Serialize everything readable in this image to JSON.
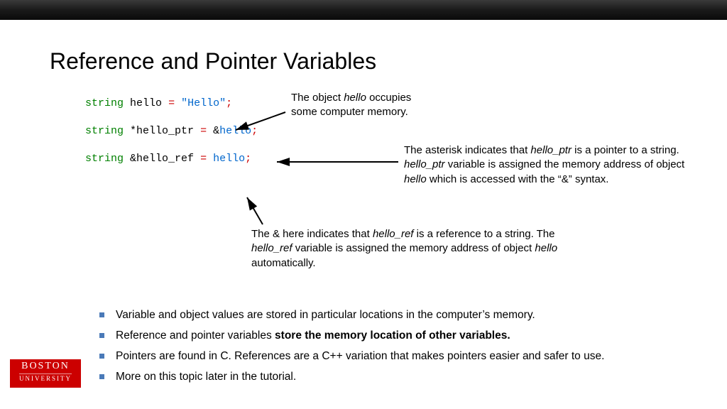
{
  "title": "Reference and Pointer Variables",
  "code": {
    "line1": {
      "kw": "string",
      "sp1": " ",
      "id": "hello",
      "sp2": " ",
      "op1": "=",
      "sp3": " ",
      "str": "\"Hello\"",
      "op2": ";"
    },
    "line2": {
      "kw": "string",
      "sp1": " ",
      "star": "*",
      "id": "hello_ptr",
      "sp2": " ",
      "op1": "=",
      "sp3": " ",
      "amp": "&",
      "ref": "hello",
      "op2": ";"
    },
    "line3": {
      "kw": "string",
      "sp1": " ",
      "amp": "&",
      "id": "hello_ref",
      "sp2": " ",
      "op1": "=",
      "sp3": " ",
      "ref": "hello",
      "op2": ";"
    }
  },
  "annotations": {
    "a1": "The object <em>hello</em> occupies some computer memory.",
    "a2": "The asterisk indicates that <em>hello_ptr</em> is a pointer to a string. <em>hello_ptr</em> variable is assigned the memory address of object <em>hello</em> which is accessed with the “&” syntax.",
    "a3": "The & here indicates that <em>hello_ref</em> is a reference to a string. The <em>hello_ref</em> variable is assigned the memory address of object <em>hello</em> automatically."
  },
  "bullets": [
    "Variable and object values are stored in particular locations in the computer’s memory.",
    "Reference and pointer variables <b>store the memory location of other variables.</b>",
    "Pointers are found in C. References are a C++ variation that makes pointers easier and safer to use.",
    "More on this topic later in the tutorial."
  ],
  "logo": {
    "l1": "BOSTON",
    "l2": "UNIVERSITY"
  }
}
